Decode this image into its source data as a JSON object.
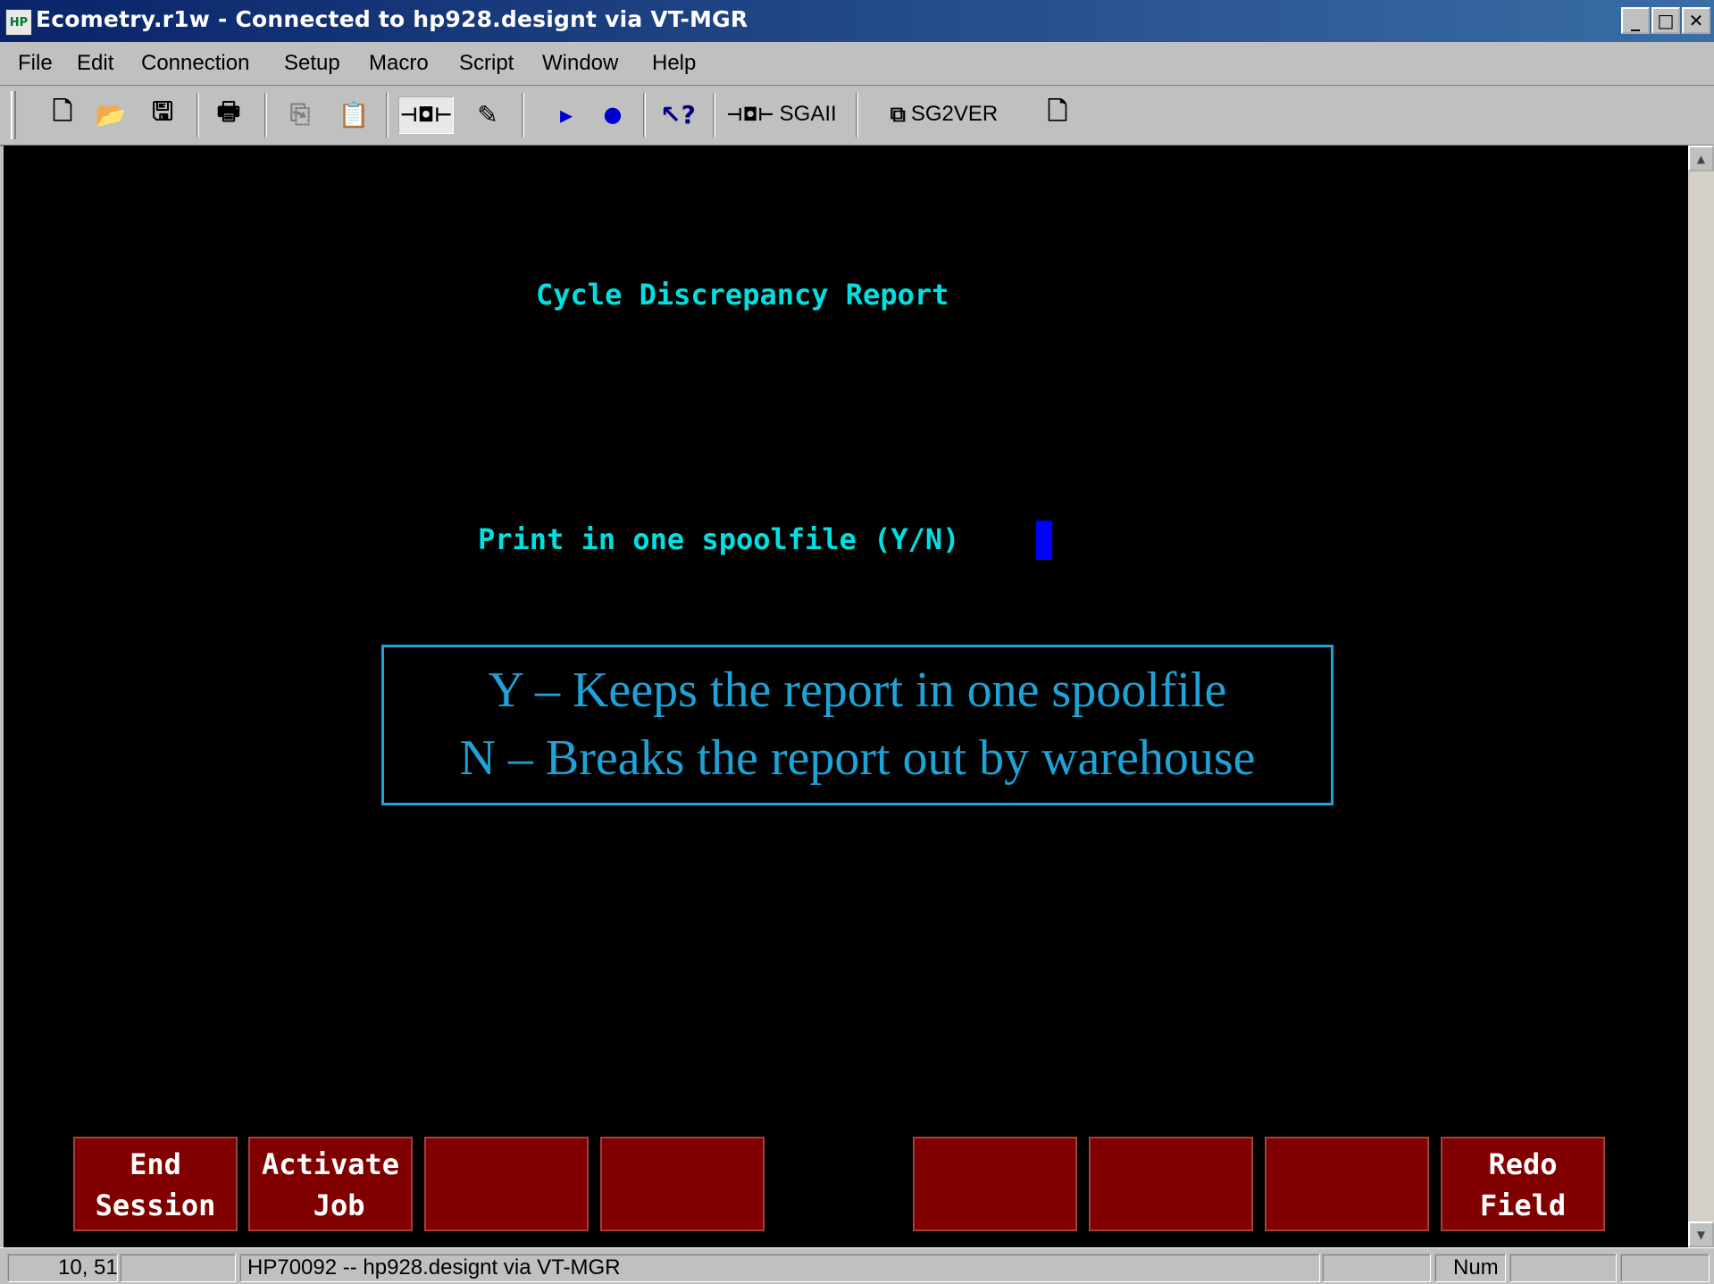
{
  "window": {
    "title": "Ecometry.r1w - Connected to hp928.designt via VT-MGR",
    "app_icon_text": "HP",
    "controls": {
      "minimize": "_",
      "maximize": "□",
      "close": "✕"
    }
  },
  "menubar": {
    "items": [
      "File",
      "Edit",
      "Connection",
      "Setup",
      "Macro",
      "Script",
      "Window",
      "Help"
    ]
  },
  "toolbar": {
    "buttons": [
      {
        "icon": "new-document-icon",
        "glyph": "🗋"
      },
      {
        "icon": "open-folder-icon",
        "glyph": "📂"
      },
      {
        "icon": "save-icon",
        "glyph": "🖫"
      },
      {
        "icon": "print-icon",
        "glyph": "🖶"
      },
      {
        "icon": "copy-icon",
        "glyph": "⎘"
      },
      {
        "icon": "paste-icon",
        "glyph": "📋"
      },
      {
        "icon": "connect-icon",
        "glyph": "⊣◘⊢"
      },
      {
        "icon": "script-icon",
        "glyph": "✎"
      },
      {
        "icon": "play-icon",
        "glyph": "▸"
      },
      {
        "icon": "record-icon",
        "glyph": "●"
      },
      {
        "icon": "context-help-icon",
        "glyph": "↖?"
      }
    ],
    "sgaii_label": "SGAII",
    "sg2ver_label": "SG2VER"
  },
  "terminal": {
    "heading": "Cycle Discrepancy Report",
    "prompt": "Print in one spoolfile (Y/N)",
    "callout_line1": "Y – Keeps the report in one spoolfile",
    "callout_line2": "N – Breaks the report out by warehouse",
    "fkeys": [
      "End\nSession",
      "Activate\n Job",
      "",
      "",
      "",
      "",
      "",
      "Redo\nField"
    ]
  },
  "statusbar": {
    "position": "10, 51",
    "connection": "HP70092 -- hp928.designt via VT-MGR",
    "num": "Num"
  },
  "colors": {
    "terminal_text": "#00e0e0",
    "cursor": "#0000ff",
    "callout": "#1fa3d6",
    "fkey_bg": "#800000"
  }
}
